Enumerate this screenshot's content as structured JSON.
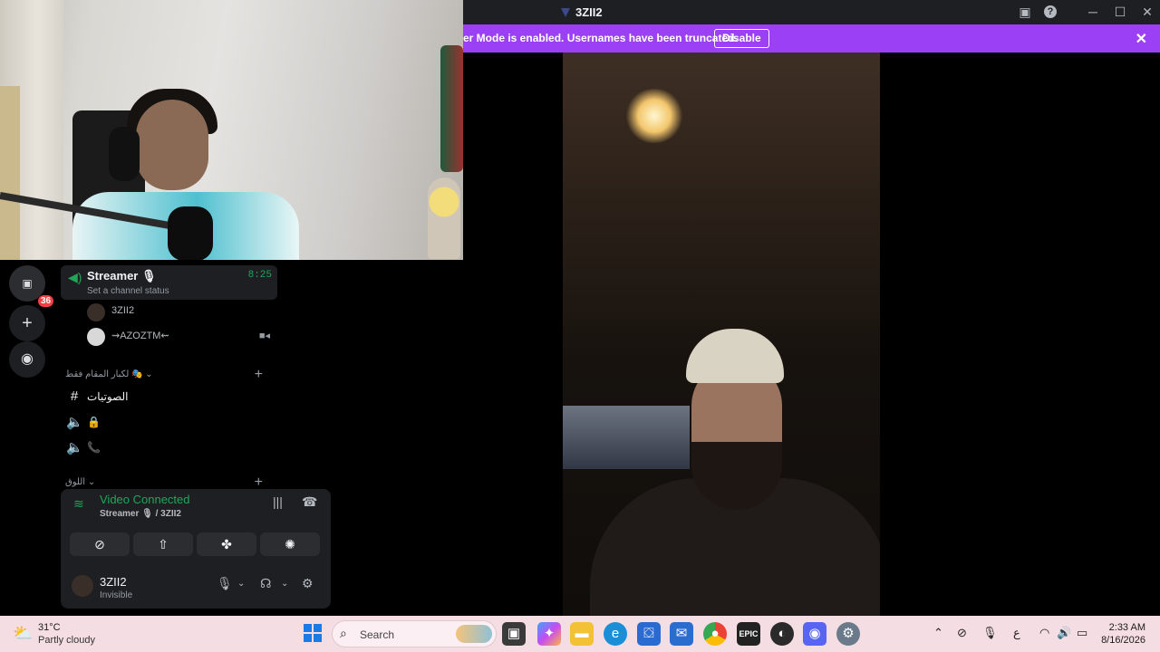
{
  "window": {
    "title": "3ZII2"
  },
  "banner": {
    "message": "er Mode is enabled. Usernames have been truncated.",
    "button": "Disable"
  },
  "voice_channel": {
    "name": "Streamer 🎙",
    "status_placeholder": "Set a channel status",
    "timer": "8:25",
    "members": [
      {
        "name": "3ZII2"
      },
      {
        "name": "⇝AZOZTM⇜"
      }
    ]
  },
  "guilds": {
    "mention_badge": "36"
  },
  "categories": [
    {
      "label": "لكبار المقام فقط 🎭",
      "channels": [
        {
          "label": "الصوتيات",
          "icon": "hash-icon"
        },
        {
          "label": "🔒",
          "icon": "speaker-icon"
        },
        {
          "label": "📞",
          "icon": "speaker-icon"
        }
      ]
    },
    {
      "label": "اللوق"
    }
  ],
  "voice_panel": {
    "status": "Video Connected",
    "subtitle": "Streamer 🎙 / 3ZII2"
  },
  "user": {
    "name": "3ZII2",
    "status": "Invisible"
  },
  "taskbar": {
    "temperature": "31°C",
    "condition": "Partly cloudy",
    "search_placeholder": "Search",
    "time": "2:33 AM",
    "date": "8/16/2026",
    "input_lang": "ع"
  },
  "colors": {
    "accent": "#9b40f5",
    "connected": "#23a559",
    "danger": "#f23f43"
  }
}
